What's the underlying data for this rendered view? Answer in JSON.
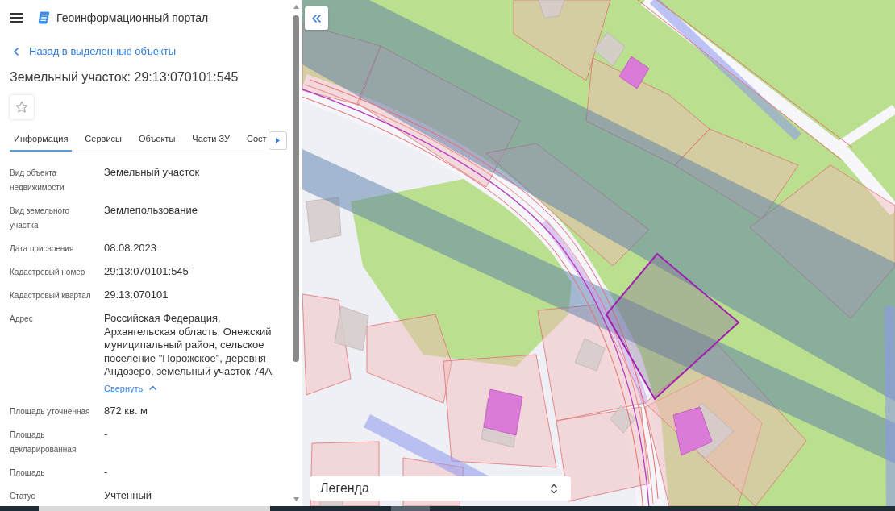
{
  "header": {
    "title": "Геоинформационный портал"
  },
  "back_link": {
    "label": "Назад в выделенные объекты"
  },
  "object": {
    "title": "Земельный участок: 29:13:070101:545",
    "favorite": false
  },
  "tabs": [
    {
      "label": "Информация",
      "selected": true
    },
    {
      "label": "Сервисы",
      "selected": false
    },
    {
      "label": "Объекты",
      "selected": false
    },
    {
      "label": "Части ЗУ",
      "selected": false
    },
    {
      "label": "Сост",
      "selected": false
    }
  ],
  "properties": [
    {
      "label": "Вид объекта недвижимости",
      "value": "Земельный участок"
    },
    {
      "label": "Вид земельного участка",
      "value": "Землепользование"
    },
    {
      "label": "Дата присвоения",
      "value": "08.08.2023"
    },
    {
      "label": "Кадастровый номер",
      "value": "29:13:070101:545"
    },
    {
      "label": "Кадастровый квартал",
      "value": "29:13:070101"
    },
    {
      "label": "Адрес",
      "value": "Российская Федерация, Архангельская область, Онежский муниципальный район, сельское поселение \"Порожское\", деревня Андозеро, земельный участок 74А",
      "toggle": {
        "label": "Свернуть",
        "expanded": true
      }
    },
    {
      "label": "Площадь уточненная",
      "value": "872 кв. м"
    },
    {
      "label": "Площадь декларированная",
      "value": "-"
    },
    {
      "label": "Площадь",
      "value": "-"
    },
    {
      "label": "Статус",
      "value": "Учтенный"
    }
  ],
  "map": {
    "legend": {
      "label": "Легенда"
    }
  }
}
